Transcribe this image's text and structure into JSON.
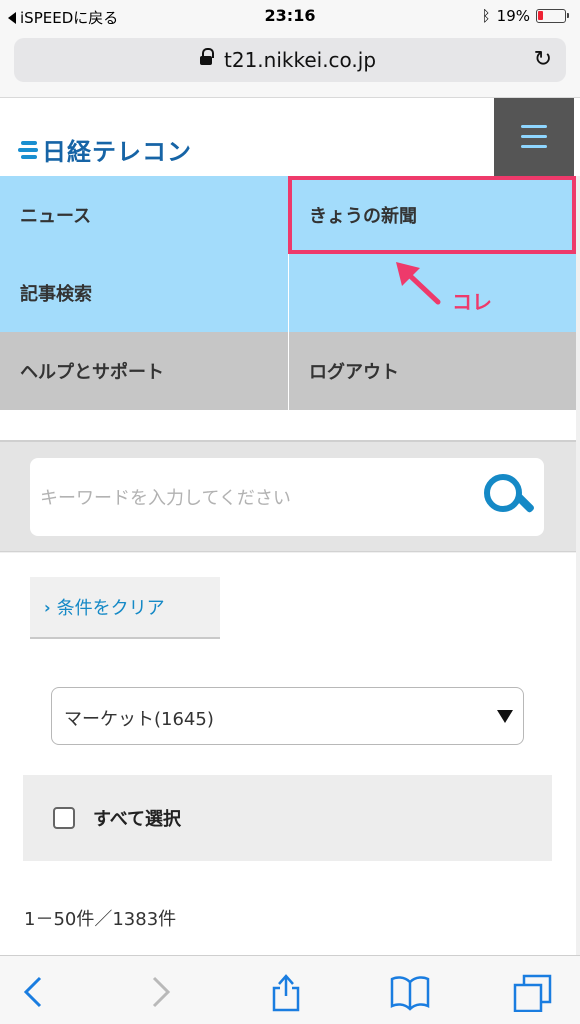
{
  "status_bar": {
    "back_app": "iSPEEDに戻る",
    "time": "23:16",
    "battery": "19%",
    "battery_level": 0.19
  },
  "browser": {
    "host": "t21.nikkei.co.jp",
    "reload_icon": "reload-icon",
    "lock_icon": "lock-icon"
  },
  "header": {
    "logo_text": "日経テレコン",
    "menu_icon": "hamburger-icon"
  },
  "nav": {
    "items": [
      {
        "label": "ニュース"
      },
      {
        "label": "きょうの新聞"
      },
      {
        "label": "記事検索"
      },
      {
        "label": ""
      },
      {
        "label": "ヘルプとサポート"
      },
      {
        "label": "ログアウト"
      }
    ]
  },
  "annotation": {
    "text": "コレ",
    "color": "#ee3a6b"
  },
  "search": {
    "placeholder": "キーワードを入力してください",
    "icon": "search-icon"
  },
  "filters": {
    "clear_label": "条件をクリア",
    "select_value": "マーケット(1645)",
    "select_all_label": "すべて選択",
    "result_count": "1－50件／1383件"
  },
  "toolbar": {
    "icons": [
      "back-icon",
      "forward-icon",
      "share-icon",
      "bookmarks-icon",
      "tabs-icon"
    ]
  },
  "colors": {
    "nav_blue": "#a3dcfb",
    "nav_gray": "#c6c6c6",
    "accent": "#1589c6",
    "highlight": "#ee3a6b"
  }
}
